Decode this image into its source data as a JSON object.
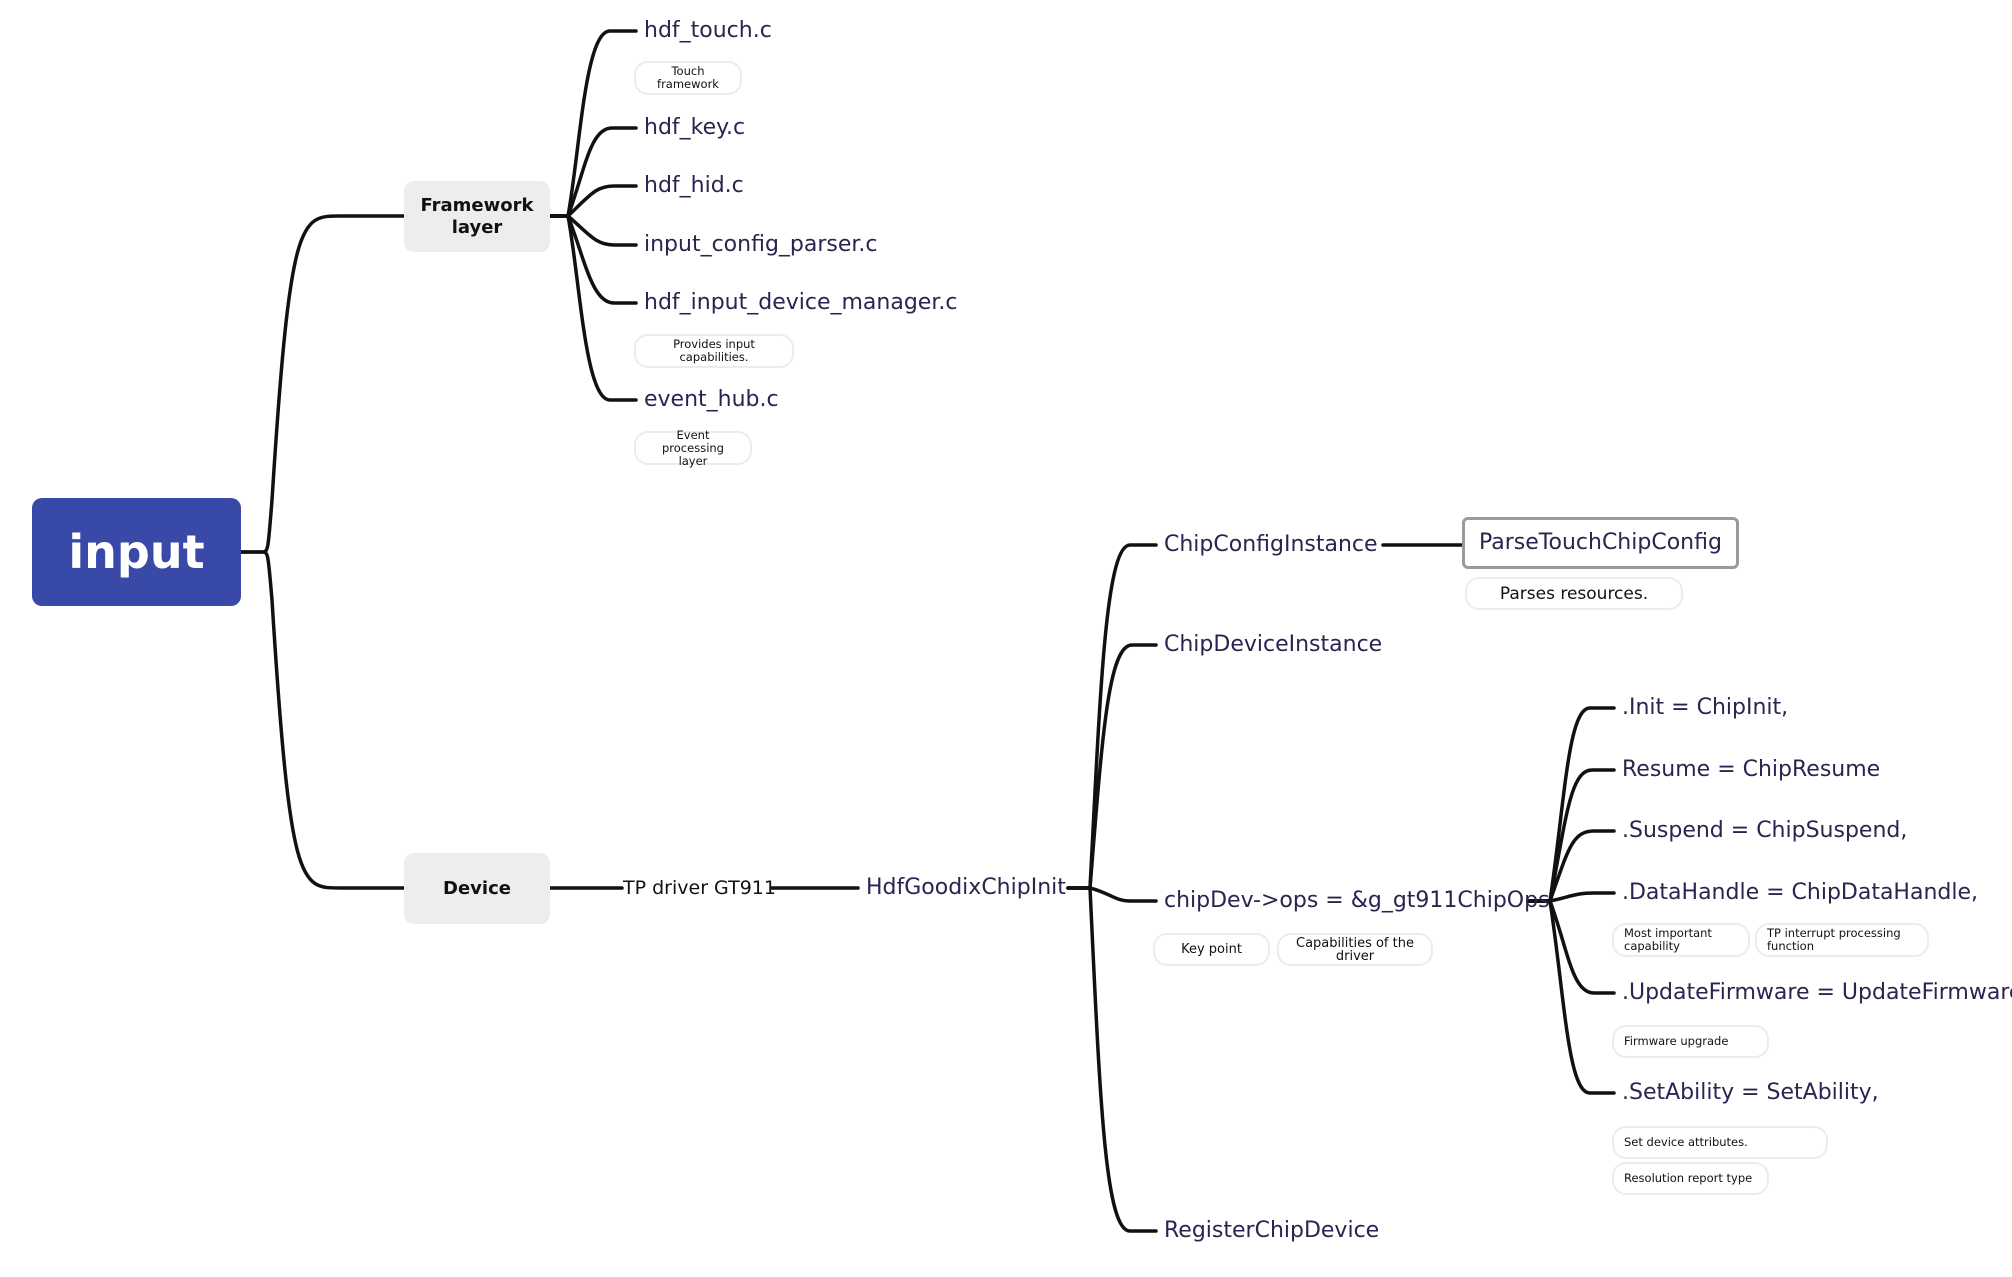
{
  "root": {
    "label": "input",
    "color": "#3949a8"
  },
  "framework": {
    "label": "Framework layer",
    "children": [
      {
        "label": "hdf_touch.c",
        "note": "Touch framework"
      },
      {
        "label": "hdf_key.c"
      },
      {
        "label": "hdf_hid.c"
      },
      {
        "label": "input_config_parser.c"
      },
      {
        "label": "hdf_input_device_manager.c",
        "note": "Provides input capabilities."
      },
      {
        "label": "event_hub.c",
        "note": "Event processing layer"
      }
    ]
  },
  "device": {
    "label": "Device",
    "driver": "TP driver GT911",
    "init": "HdfGoodixChipInit",
    "children": {
      "config": {
        "label": "ChipConfigInstance",
        "child": "ParseTouchChipConfig",
        "child_note": "Parses resources."
      },
      "instance": {
        "label": "ChipDeviceInstance"
      },
      "ops": {
        "label": "chipDev->ops = &g_gt911ChipOps",
        "notes": [
          "Key point",
          "Capabilities of the driver"
        ],
        "items": [
          {
            "label": ".Init = ChipInit,"
          },
          {
            "label": "Resume = ChipResume"
          },
          {
            "label": ".Suspend = ChipSuspend,"
          },
          {
            "label": ".DataHandle = ChipDataHandle,",
            "notes": [
              "Most important capability",
              "TP interrupt processing function"
            ]
          },
          {
            "label": ".UpdateFirmware = UpdateFirmware,",
            "notes": [
              "Firmware upgrade"
            ]
          },
          {
            "label": ".SetAbility = SetAbility,",
            "notes": [
              "Set device attributes.",
              "Resolution report type"
            ]
          }
        ]
      },
      "register": {
        "label": "RegisterChipDevice"
      }
    }
  }
}
